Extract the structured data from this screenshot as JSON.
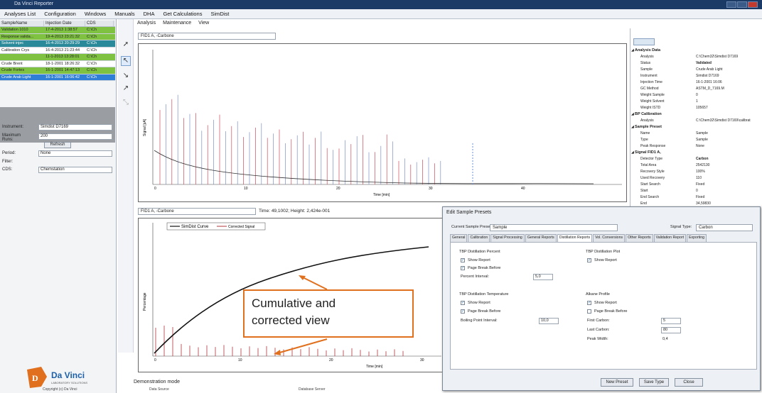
{
  "titlebar": {
    "title": "Da Vinci Reporter"
  },
  "menu": [
    "Analyses List",
    "Configuration",
    "Windows",
    "Manuals",
    "DHA",
    "Get Calculations",
    "SimDist"
  ],
  "samples": {
    "headers": [
      "SampleName",
      "Injection Date",
      "CDS"
    ],
    "rows": [
      {
        "name": "Validation 1010",
        "date": "17-4-2013 1:38:57",
        "cds": "C:\\Ch",
        "color": "#7fc241"
      },
      {
        "name": "Response valida...",
        "date": "19-4-2013 23:21:32",
        "cds": "C:\\Ch",
        "color": "#7fc241"
      },
      {
        "name": "Solvent injec",
        "date": "16-4-2013 20:29:29",
        "cds": "C:\\Ch",
        "color": "#2a8a99"
      },
      {
        "name": "Calibration Crys",
        "date": "16-4-2013 21:23:44",
        "cds": "C:\\Ch",
        "color": "#ffffff"
      },
      {
        "name": "",
        "date": "11-1-2013 13:28:01",
        "cds": "C:\\Ch",
        "color": "#7fc241"
      },
      {
        "name": "Crude Brent",
        "date": "18-1-2001 18:26:32",
        "cds": "C:\\Ch",
        "color": "#ffffff"
      },
      {
        "name": "Crude Fortes",
        "date": "16-1-2001 14:47:13",
        "cds": "C:\\Ch",
        "color": "#7fc241"
      },
      {
        "name": "Crude Arab Light",
        "date": "16-1-2001 16:06:42",
        "cds": "C:\\Ch",
        "color": "#2f7fd6"
      }
    ]
  },
  "filters": {
    "instrument_label": "Instrument:",
    "instrument": "Simdist D7169",
    "maxruns_label": "Maximum Runs:",
    "maxruns": "200",
    "refresh": "Refresh",
    "period_label": "Period:",
    "period": "None",
    "filter_label": "Filter:",
    "cds_label": "CDS:",
    "cds": "Chemstation"
  },
  "logo": {
    "text": "Da Vinci",
    "sub": "LABORATORY SOLUTIONS"
  },
  "center": {
    "tabs": [
      "Analysis",
      "Maintenance",
      "View"
    ],
    "signal_top": "FID1 A, -Carbone",
    "signal_bottom": "FID1 A, -Carbone",
    "coords": "Time: 49,1002; Height: 2,424e-001",
    "time_label": "Time [min]",
    "y_label_top": "Signal [pA]",
    "y_label_bottom": "Percentage",
    "ticks_top": [
      "0",
      "10",
      "20",
      "30",
      "40"
    ],
    "ticks_bottom": [
      "0",
      "10",
      "20",
      "30"
    ],
    "legend_curve": "SimDist Curve",
    "legend_signal": "Corrected Signal"
  },
  "callout": {
    "line1": "Cumulative and",
    "line2": "corrected view"
  },
  "status": "Demonstration mode",
  "props": [
    {
      "k": "Analysis Data",
      "v": "",
      "sec": true
    },
    {
      "k": "Analysis",
      "v": "C:\\Chem32\\Simdist D7169"
    },
    {
      "k": "Status",
      "v": "Validated"
    },
    {
      "k": "Sample",
      "v": "Crude Arab Light"
    },
    {
      "k": "Instrument",
      "v": "Simdist D7169"
    },
    {
      "k": "Injection Time",
      "v": "16-1-2001 16:06"
    },
    {
      "k": "GC Method",
      "v": "ASTM_D_7169.M"
    },
    {
      "k": "Weight Sample",
      "v": "0"
    },
    {
      "k": "Weight Solvent",
      "v": "1"
    },
    {
      "k": "Weight ISTD",
      "v": "105657"
    },
    {
      "k": "BP Calibration",
      "v": "",
      "sec": true
    },
    {
      "k": "Analysis",
      "v": "C:\\Chem32\\Simdist D7169\\calibrat"
    },
    {
      "k": "Sample Preset",
      "v": "",
      "sec": true
    },
    {
      "k": "Name",
      "v": "Sample"
    },
    {
      "k": "Type",
      "v": "Sample"
    },
    {
      "k": "Peak Response",
      "v": "None"
    },
    {
      "k": "Signal FID1 A,",
      "v": "",
      "sec": true
    },
    {
      "k": "Detector Type",
      "v": "Carbon"
    },
    {
      "k": "Total Area",
      "v": "2542130"
    },
    {
      "k": "Recovery Style",
      "v": "100%"
    },
    {
      "k": "Used Recovery",
      "v": "110"
    },
    {
      "k": "Start Search",
      "v": "Fixed"
    },
    {
      "k": "Start",
      "v": "0"
    },
    {
      "k": "End Search",
      "v": "Fixed"
    },
    {
      "k": "End",
      "v": "34,59830"
    },
    {
      "k": "Blank",
      "v": "C:\\Chem32\\Simdist D7169\\solvent"
    },
    {
      "k": "Solvent",
      "v": "",
      "sec": true
    },
    {
      "k": "Start Time of Solvent",
      "v": "0"
    },
    {
      "k": "End Time of Solvent",
      "v": "0"
    }
  ],
  "dialog": {
    "title": "Edit Sample Presets",
    "preset_label": "Current Sample Preset:",
    "preset": "Sample",
    "signal_label": "Signal Type:",
    "signal": "Carbon",
    "tabs": [
      "General",
      "Calibration",
      "Signal Processing",
      "General Reports",
      "Distillation Reports",
      "Vol. Conversions",
      "Other Reports",
      "Validation Report",
      "Exporting"
    ],
    "active_tab": 4,
    "tbp_percent": {
      "title": "TBP Distillation Percent",
      "show": "Show Report",
      "page": "Page Break Before",
      "interval_label": "Percent Interval:",
      "interval": "5,0"
    },
    "tbp_plot": {
      "title": "TBP Distillation Plot",
      "show": "Show Report"
    },
    "tbp_temp": {
      "title": "TBP Distillation Temperature",
      "show": "Show Report",
      "page": "Page Break Before",
      "interval_label": "Boiling Point Interval:",
      "interval": "10,0"
    },
    "alkane": {
      "title": "Alkane Profile",
      "show": "Show Report",
      "page": "Page Break Before",
      "first_label": "First Carbon:",
      "first": "5",
      "last_label": "Last Carbon:",
      "last": "80",
      "width_label": "Peak Width:",
      "width": "0,4"
    },
    "buttons": [
      "New Preset",
      "Save Type",
      "Close"
    ]
  },
  "footer": [
    "Copyright (c) Da Vinci",
    "Data Source",
    "Database Server"
  ]
}
